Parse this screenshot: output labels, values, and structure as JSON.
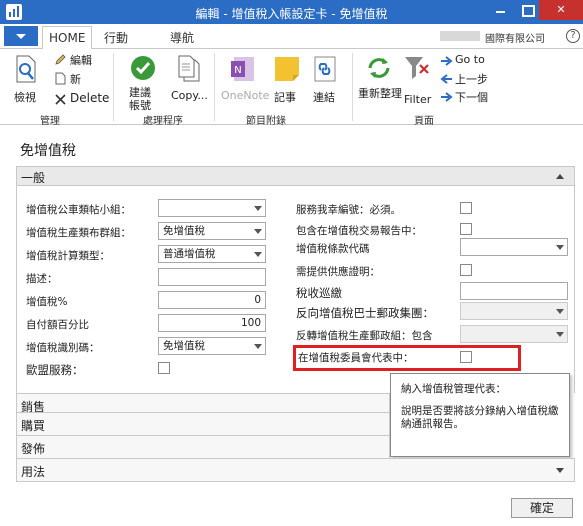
{
  "window": {
    "title": "編輯 - 增值稅入帳設定卡 - 免增值稅",
    "minimize_label": "",
    "restore_label": "",
    "close_label": "✕"
  },
  "tabs": {
    "home": "HOME",
    "actions": "行動",
    "navigate": "導航"
  },
  "header": {
    "company": "國際有限公司",
    "help": "?"
  },
  "ribbon": {
    "view": "檢視",
    "edit": "編輯",
    "new": "新",
    "delete": "Delete",
    "manage_group": "管理",
    "suggest_accounts_line1": "建議",
    "suggest_accounts_line2": "帳號",
    "copy": "Copy...",
    "process_group": "處理程序",
    "onenote": "OneNote",
    "notes": "記事",
    "links": "連結",
    "attachments_group": "節目附錄",
    "refresh": "重新整理",
    "filter": "Filter",
    "goto": "Go to",
    "previous": "上一步",
    "next": "下一個",
    "page_group": "頁面",
    "icons": [
      "view-icon",
      "edit-icon",
      "new-icon",
      "delete-icon",
      "checkmark-icon",
      "copy-icon",
      "onenote-icon",
      "note-icon",
      "link-icon",
      "refresh-icon",
      "filter-icon",
      "arrow-right-icon",
      "arrow-left-icon",
      "arrow-right-icon"
    ]
  },
  "page": {
    "title": "免增值稅"
  },
  "general": {
    "header": "一般",
    "fields": {
      "vat_bus_posting_group_label": "增值稅公車類帖小組：",
      "vat_prod_posting_group_label": "增值稅生產類布群組：",
      "vat_prod_posting_group_value": "免增值稅",
      "vat_calc_type_label": "增值稅計算類型：",
      "vat_calc_type_value": "普通增值稅",
      "description_label": "描述：",
      "vat_percent_label": "增值稅%",
      "vat_percent_value": "0",
      "self_payment_percent_label": "自付額百分比",
      "self_payment_percent_value": "100",
      "vat_identifier_label": "增值稅識別碼：",
      "vat_identifier_value": "免增值稅",
      "eu_service_label": "歐盟服務：",
      "cert_required_label": "服務我幸編號：必須。",
      "include_in_report_label": "包含在增值稅交易報告中：",
      "vat_clause_code_label": "增值稅條款代碼",
      "certificate_required_label": "需提供供應證明：",
      "tax_category_label": "稅收巡繳",
      "reverse_chrg_group_label": "反向增值稅巴士郵政集團：",
      "reverse_chrg_prod_label": "反轉增值稅生產郵政組：包含",
      "include_in_vat_rep_label": "在增值稅委員會代表中："
    }
  },
  "tooltip": {
    "title": "納入增值稅管理代表：",
    "body": "說明是否要將該分錄納入增值稅繳納通訊報告。"
  },
  "sections": {
    "sales": "銷售",
    "purchases": "購買",
    "settlement": "發佈",
    "usage": "用法"
  },
  "footer": {
    "ok": "確定"
  },
  "colors": {
    "titlebar": "#2b6cc4",
    "close": "#c7312d",
    "highlight": "#e02020",
    "ribbon_green": "#3a9a3a",
    "onenote_purple": "#8a4fb0",
    "note_yellow": "#f2c230",
    "nav_blue": "#2b6cc4"
  }
}
